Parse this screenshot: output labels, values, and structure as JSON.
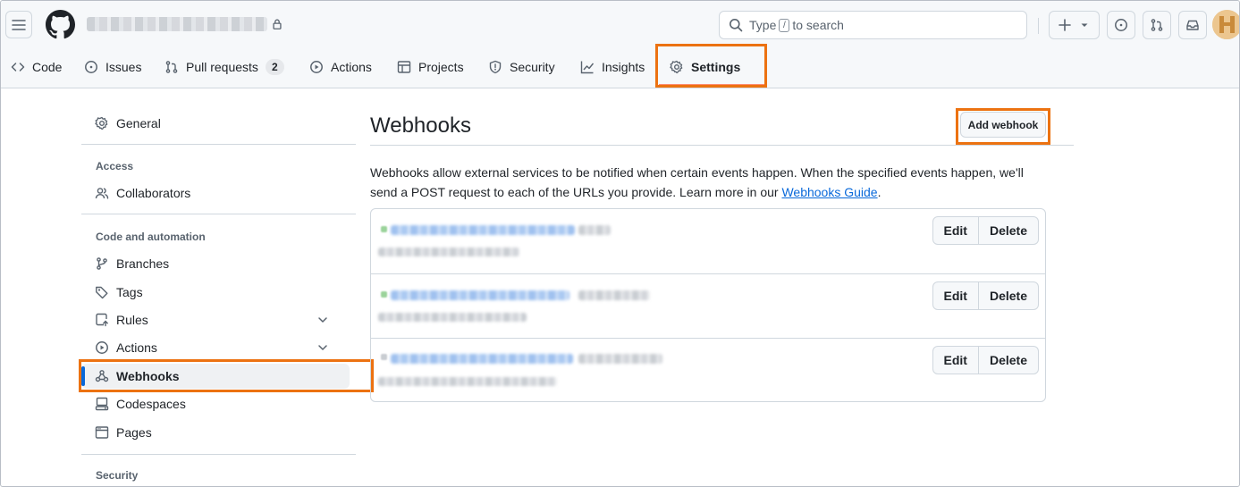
{
  "header": {
    "search_placeholder_prefix": "Type",
    "search_shortcut_key": "/",
    "search_placeholder_suffix": "to search"
  },
  "nav": {
    "tabs": [
      {
        "label": "Code",
        "icon": "code-icon"
      },
      {
        "label": "Issues",
        "icon": "issue-icon"
      },
      {
        "label": "Pull requests",
        "icon": "pull-request-icon",
        "count": "2"
      },
      {
        "label": "Actions",
        "icon": "play-icon"
      },
      {
        "label": "Projects",
        "icon": "table-icon"
      },
      {
        "label": "Security",
        "icon": "shield-icon"
      },
      {
        "label": "Insights",
        "icon": "graph-icon"
      },
      {
        "label": "Settings",
        "icon": "gear-icon",
        "active": true
      }
    ]
  },
  "sidebar": {
    "general": "General",
    "access_heading": "Access",
    "collaborators": "Collaborators",
    "code_heading": "Code and automation",
    "branches": "Branches",
    "tags": "Tags",
    "rules": "Rules",
    "actions": "Actions",
    "webhooks": "Webhooks",
    "codespaces": "Codespaces",
    "pages": "Pages",
    "security_heading": "Security"
  },
  "main": {
    "title": "Webhooks",
    "add_button": "Add webhook",
    "description": "Webhooks allow external services to be notified when certain events happen. When the specified events happen, we'll send a POST request to each of the URLs you provide. Learn more in our ",
    "guide_link": "Webhooks Guide",
    "description_end": ".",
    "edit_label": "Edit",
    "delete_label": "Delete"
  },
  "colors": {
    "highlight": "#ec7211",
    "link": "#0969da",
    "active_tab_underline": "#fd8c73"
  }
}
